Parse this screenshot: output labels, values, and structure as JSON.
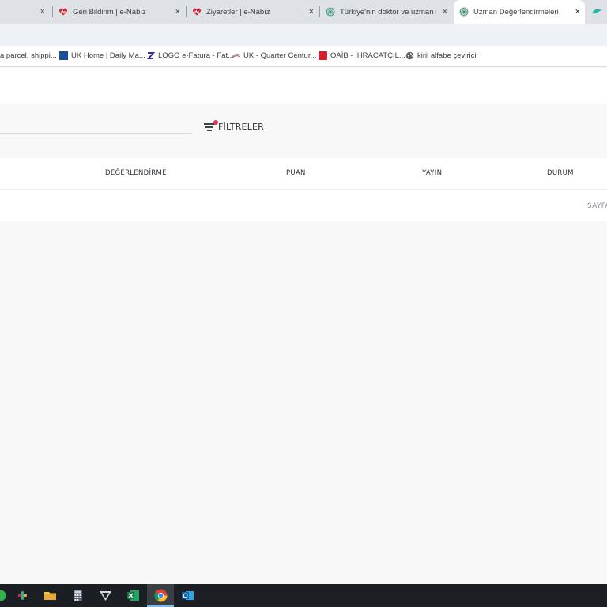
{
  "browser": {
    "tabs": [
      {
        "title": "",
        "close": "×"
      },
      {
        "title": "Geri Bildirim | e-Nabız",
        "close": "×"
      },
      {
        "title": "Ziyaretler | e-Nabız",
        "close": "×"
      },
      {
        "title": "Türkiye'nin doktor ve uzman ra",
        "close": "×"
      },
      {
        "title": "Uzman Değerlendirmeleri",
        "close": "×"
      }
    ],
    "bookmarks": [
      {
        "label": "a parcel, shippi..."
      },
      {
        "label": "UK Home | Daily Ma..."
      },
      {
        "label": "LOGO e-Fatura - Fat..."
      },
      {
        "label": "UK - Quarter Centur..."
      },
      {
        "label": "OAİB - İHRACATÇIL..."
      },
      {
        "label": "kiril alfabe çevirici"
      }
    ]
  },
  "filters": {
    "button_label": "FİLTRELER"
  },
  "table": {
    "columns": [
      "DEĞERLENDİRME",
      "PUAN",
      "YAYIN",
      "DURUM"
    ],
    "pager_text": "SAYFA"
  },
  "colors": {
    "filter_dot": "#e0394a",
    "tab_bg": "#dee1e6",
    "toolbar_bg": "#eef1f6",
    "page_bg": "#f8f8f9",
    "taskbar_bg": "#1b1f24"
  },
  "taskbar": {
    "icons": [
      "app-icon",
      "slack-icon",
      "file-explorer-icon",
      "calculator-icon",
      "vpn-icon",
      "excel-icon",
      "chrome-icon",
      "outlook-icon"
    ]
  }
}
